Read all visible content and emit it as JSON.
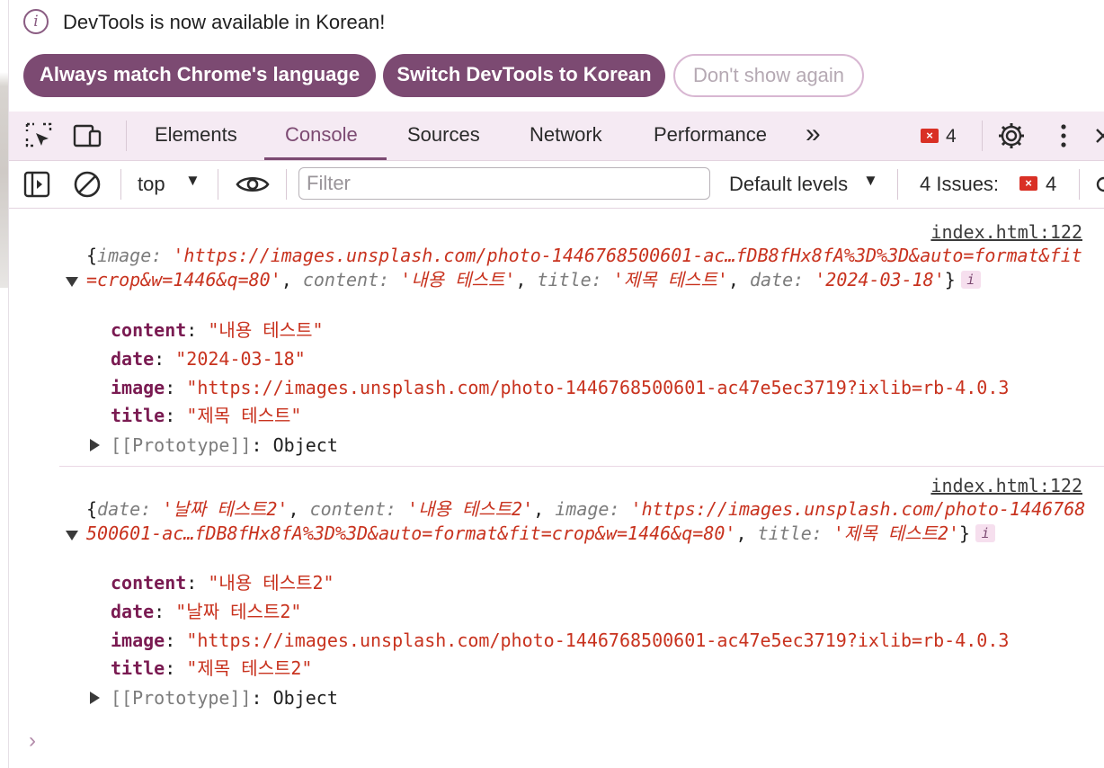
{
  "banner": {
    "message": "DevTools is now available in Korean!",
    "buttons": {
      "match": "Always match Chrome's language",
      "switch": "Switch DevTools to Korean",
      "dismiss": "Don't show again"
    }
  },
  "tabs": [
    "Elements",
    "Console",
    "Sources",
    "Network",
    "Performance"
  ],
  "active_tab": "Console",
  "toolbar": {
    "error_count": "4",
    "more": "»"
  },
  "console_toolbar": {
    "context": "top",
    "filter_placeholder": "Filter",
    "levels": "Default levels",
    "issues_label": "4 Issues:",
    "issues_count": "4"
  },
  "logs": [
    {
      "source": "index.html:122",
      "summary": {
        "open": "{",
        "parts": [
          {
            "key": "image",
            "value": "'https://images.unsplash.com/photo-1446768500601-ac…fDB8fHx8fA%3D%3D&auto=format&fit=crop&w=1446&q=80'"
          },
          {
            "key": "content",
            "value": "'내용 테스트'"
          },
          {
            "key": "title",
            "value": "'제목 테스트'"
          },
          {
            "key": "date",
            "value": "'2024-03-18'"
          }
        ],
        "close": "}"
      },
      "info_badge": "i",
      "props": [
        {
          "key": "content",
          "value": "\"내용 테스트\""
        },
        {
          "key": "date",
          "value": "\"2024-03-18\""
        },
        {
          "key": "image",
          "value": "\"https://images.unsplash.com/photo-1446768500601-ac47e5ec3719?ixlib=rb-4.0.3"
        },
        {
          "key": "title",
          "value": "\"제목 테스트\""
        }
      ],
      "prototype": {
        "key": "[[Prototype]]",
        "value": "Object"
      }
    },
    {
      "source": "index.html:122",
      "summary": {
        "open": "{",
        "parts": [
          {
            "key": "date",
            "value": "'날짜 테스트2'"
          },
          {
            "key": "content",
            "value": "'내용 테스트2'"
          },
          {
            "key": "image",
            "value": "'https://images.unsplash.com/photo-1446768500601-ac…fDB8fHx8fA%3D%3D&auto=format&fit=crop&w=1446&q=80'"
          },
          {
            "key": "title",
            "value": "'제목 테스트2'"
          }
        ],
        "close": "}"
      },
      "info_badge": "i",
      "props": [
        {
          "key": "content",
          "value": "\"내용 테스트2\""
        },
        {
          "key": "date",
          "value": "\"날짜 테스트2\""
        },
        {
          "key": "image",
          "value": "\"https://images.unsplash.com/photo-1446768500601-ac47e5ec3719?ixlib=rb-4.0.3"
        },
        {
          "key": "title",
          "value": "\"제목 테스트2\""
        }
      ],
      "prototype": {
        "key": "[[Prototype]]",
        "value": "Object"
      }
    }
  ],
  "prompt": "›",
  "colors": {
    "accent": "#7c4a72",
    "string": "#c8321e",
    "key": "#7a1b52",
    "error": "#d93025",
    "toolbar_bg": "#f5eaf3"
  }
}
